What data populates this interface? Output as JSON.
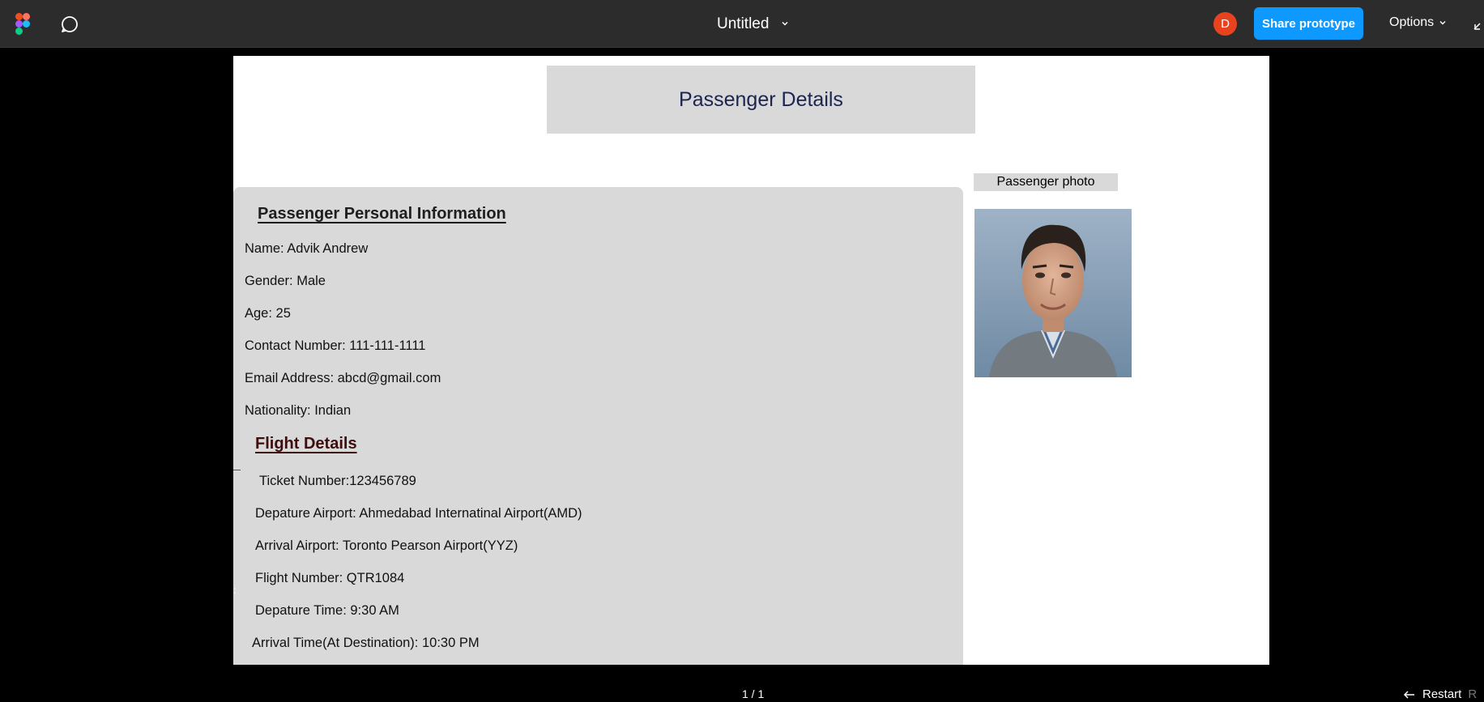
{
  "toolbar": {
    "doc_title": "Untitled",
    "avatar_initial": "D",
    "share_label": "Share prototype",
    "options_label": "Options",
    "colors": {
      "bar": "#2c2c2c",
      "share_button": "#0d99ff",
      "avatar": "#e8431e"
    }
  },
  "frame": {
    "header_title": "Passenger Details",
    "photo_label": "Passenger photo",
    "personal": {
      "heading": "Passenger Personal Information",
      "lines": [
        "Name: Advik Andrew",
        "Gender: Male",
        "Age: 25",
        "Contact Number: 111-111-1111",
        "Email Address: abcd@gmail.com",
        "Nationality: Indian"
      ]
    },
    "flight": {
      "heading": "Flight Details",
      "lines": [
        "Ticket Number:123456789",
        "Depature Airport: Ahmedabad Internatinal Airport(AMD)",
        "Arrival Airport: Toronto Pearson Airport(YYZ)",
        "Flight Number: QTR1084",
        "Depature Time: 9:30 AM",
        "Arrival Time(At Destination): 10:30 PM"
      ]
    },
    "stray_colon": ":"
  },
  "footer": {
    "page_counter": "1 / 1",
    "restart_label": "Restart",
    "restart_key": "R"
  }
}
